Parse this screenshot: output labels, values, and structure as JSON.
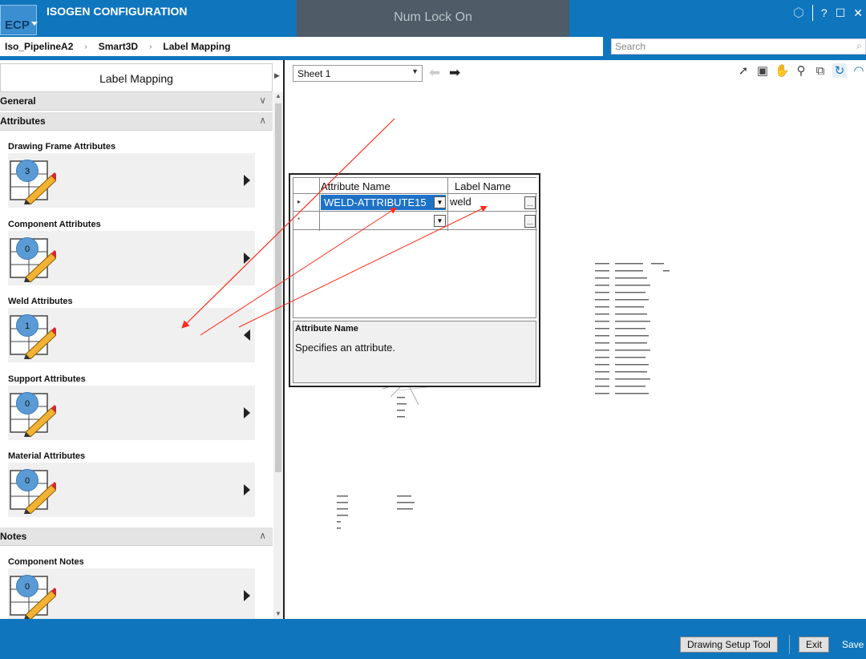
{
  "titlebar": {
    "logo": "ECP",
    "title": "ISOGEN CONFIGURATION",
    "overlay": "Num Lock On",
    "controls": {
      "help": "?"
    }
  },
  "breadcrumb": {
    "items": [
      "Iso_PipelineA2",
      "Smart3D",
      "Label Mapping"
    ],
    "separator": "›"
  },
  "search": {
    "placeholder": "Search"
  },
  "left_panel": {
    "header": "Label Mapping",
    "sections": {
      "general": "General",
      "attributes": "Attributes",
      "notes": "Notes"
    },
    "attribute_items": [
      {
        "title": "Drawing Frame Attributes",
        "count": "3"
      },
      {
        "title": "Component Attributes",
        "count": "0"
      },
      {
        "title": "Weld Attributes",
        "count": "1"
      },
      {
        "title": "Support Attributes",
        "count": "0"
      },
      {
        "title": "Material Attributes",
        "count": "0"
      }
    ],
    "note_items": [
      {
        "title": "Component Notes",
        "count": "0"
      }
    ]
  },
  "viewer": {
    "sheet": "Sheet 1",
    "nav_back": "⬅",
    "nav_forward": "➡"
  },
  "dialog": {
    "columns": [
      "Attribute Name",
      "Label Name"
    ],
    "rows": [
      {
        "marker": "▸",
        "attribute": "WELD-ATTRIBUTE15",
        "label": "weld"
      },
      {
        "marker": "*",
        "attribute": "",
        "label": ""
      }
    ],
    "ellipsis": "...",
    "help": {
      "title": "Attribute Name",
      "description": "Specifies an attribute."
    }
  },
  "footer": {
    "drawing_setup": "Drawing Setup Tool",
    "exit": "Exit",
    "save": "Save"
  },
  "colors": {
    "brand_blue": "#0f75bd",
    "selection_blue": "#1d72c8",
    "annotation_red": "#ff2a1a",
    "badge_blue": "#5b9bd5"
  }
}
